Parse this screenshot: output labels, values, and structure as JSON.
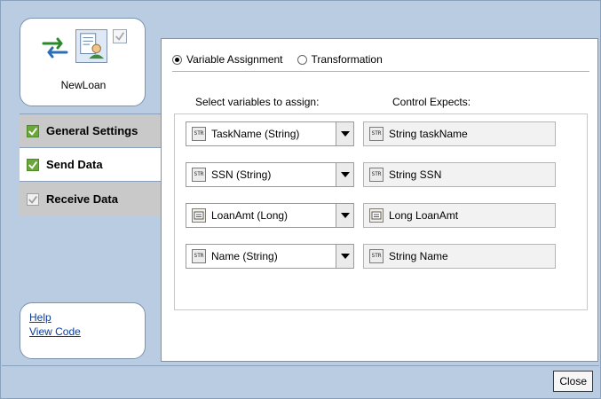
{
  "app": {
    "node_name": "NewLoan"
  },
  "nav": {
    "items": [
      {
        "label": "General Settings"
      },
      {
        "label": "Send Data"
      },
      {
        "label": "Receive Data"
      }
    ]
  },
  "help": {
    "help_link": "Help",
    "view_code_link": "View Code"
  },
  "mode": {
    "options": [
      {
        "label": "Variable Assignment",
        "selected": true
      },
      {
        "label": "Transformation",
        "selected": false
      }
    ]
  },
  "columns": {
    "left": "Select variables to assign:",
    "right": "Control Expects:"
  },
  "rows": [
    {
      "icon": "string-type-icon",
      "variable": "TaskName (String)",
      "expects": "String taskName"
    },
    {
      "icon": "string-type-icon",
      "variable": "SSN (String)",
      "expects": "String SSN"
    },
    {
      "icon": "long-type-icon",
      "variable": "LoanAmt (Long)",
      "expects": "Long LoanAmt"
    },
    {
      "icon": "string-type-icon",
      "variable": "Name (String)",
      "expects": "String Name"
    }
  ],
  "footer": {
    "close_label": "Close"
  }
}
